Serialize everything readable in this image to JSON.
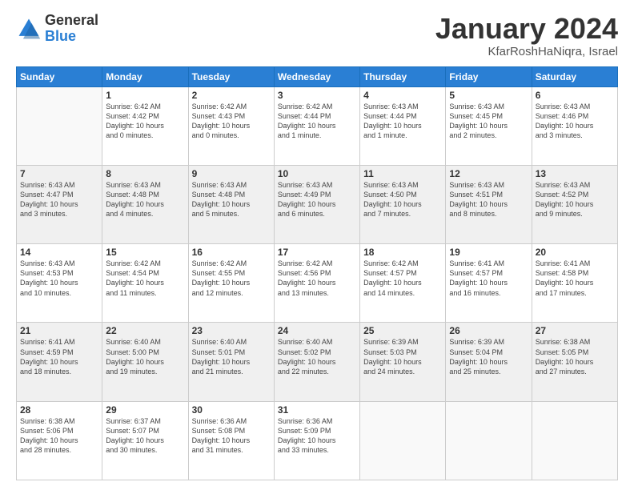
{
  "header": {
    "logo_general": "General",
    "logo_blue": "Blue",
    "month_title": "January 2024",
    "location": "KfarRoshHaNiqra, Israel"
  },
  "weekdays": [
    "Sunday",
    "Monday",
    "Tuesday",
    "Wednesday",
    "Thursday",
    "Friday",
    "Saturday"
  ],
  "weeks": [
    [
      {
        "day": "",
        "info": ""
      },
      {
        "day": "1",
        "info": "Sunrise: 6:42 AM\nSunset: 4:42 PM\nDaylight: 10 hours\nand 0 minutes."
      },
      {
        "day": "2",
        "info": "Sunrise: 6:42 AM\nSunset: 4:43 PM\nDaylight: 10 hours\nand 0 minutes."
      },
      {
        "day": "3",
        "info": "Sunrise: 6:42 AM\nSunset: 4:44 PM\nDaylight: 10 hours\nand 1 minute."
      },
      {
        "day": "4",
        "info": "Sunrise: 6:43 AM\nSunset: 4:44 PM\nDaylight: 10 hours\nand 1 minute."
      },
      {
        "day": "5",
        "info": "Sunrise: 6:43 AM\nSunset: 4:45 PM\nDaylight: 10 hours\nand 2 minutes."
      },
      {
        "day": "6",
        "info": "Sunrise: 6:43 AM\nSunset: 4:46 PM\nDaylight: 10 hours\nand 3 minutes."
      }
    ],
    [
      {
        "day": "7",
        "info": "Sunrise: 6:43 AM\nSunset: 4:47 PM\nDaylight: 10 hours\nand 3 minutes."
      },
      {
        "day": "8",
        "info": "Sunrise: 6:43 AM\nSunset: 4:48 PM\nDaylight: 10 hours\nand 4 minutes."
      },
      {
        "day": "9",
        "info": "Sunrise: 6:43 AM\nSunset: 4:48 PM\nDaylight: 10 hours\nand 5 minutes."
      },
      {
        "day": "10",
        "info": "Sunrise: 6:43 AM\nSunset: 4:49 PM\nDaylight: 10 hours\nand 6 minutes."
      },
      {
        "day": "11",
        "info": "Sunrise: 6:43 AM\nSunset: 4:50 PM\nDaylight: 10 hours\nand 7 minutes."
      },
      {
        "day": "12",
        "info": "Sunrise: 6:43 AM\nSunset: 4:51 PM\nDaylight: 10 hours\nand 8 minutes."
      },
      {
        "day": "13",
        "info": "Sunrise: 6:43 AM\nSunset: 4:52 PM\nDaylight: 10 hours\nand 9 minutes."
      }
    ],
    [
      {
        "day": "14",
        "info": "Sunrise: 6:43 AM\nSunset: 4:53 PM\nDaylight: 10 hours\nand 10 minutes."
      },
      {
        "day": "15",
        "info": "Sunrise: 6:42 AM\nSunset: 4:54 PM\nDaylight: 10 hours\nand 11 minutes."
      },
      {
        "day": "16",
        "info": "Sunrise: 6:42 AM\nSunset: 4:55 PM\nDaylight: 10 hours\nand 12 minutes."
      },
      {
        "day": "17",
        "info": "Sunrise: 6:42 AM\nSunset: 4:56 PM\nDaylight: 10 hours\nand 13 minutes."
      },
      {
        "day": "18",
        "info": "Sunrise: 6:42 AM\nSunset: 4:57 PM\nDaylight: 10 hours\nand 14 minutes."
      },
      {
        "day": "19",
        "info": "Sunrise: 6:41 AM\nSunset: 4:57 PM\nDaylight: 10 hours\nand 16 minutes."
      },
      {
        "day": "20",
        "info": "Sunrise: 6:41 AM\nSunset: 4:58 PM\nDaylight: 10 hours\nand 17 minutes."
      }
    ],
    [
      {
        "day": "21",
        "info": "Sunrise: 6:41 AM\nSunset: 4:59 PM\nDaylight: 10 hours\nand 18 minutes."
      },
      {
        "day": "22",
        "info": "Sunrise: 6:40 AM\nSunset: 5:00 PM\nDaylight: 10 hours\nand 19 minutes."
      },
      {
        "day": "23",
        "info": "Sunrise: 6:40 AM\nSunset: 5:01 PM\nDaylight: 10 hours\nand 21 minutes."
      },
      {
        "day": "24",
        "info": "Sunrise: 6:40 AM\nSunset: 5:02 PM\nDaylight: 10 hours\nand 22 minutes."
      },
      {
        "day": "25",
        "info": "Sunrise: 6:39 AM\nSunset: 5:03 PM\nDaylight: 10 hours\nand 24 minutes."
      },
      {
        "day": "26",
        "info": "Sunrise: 6:39 AM\nSunset: 5:04 PM\nDaylight: 10 hours\nand 25 minutes."
      },
      {
        "day": "27",
        "info": "Sunrise: 6:38 AM\nSunset: 5:05 PM\nDaylight: 10 hours\nand 27 minutes."
      }
    ],
    [
      {
        "day": "28",
        "info": "Sunrise: 6:38 AM\nSunset: 5:06 PM\nDaylight: 10 hours\nand 28 minutes."
      },
      {
        "day": "29",
        "info": "Sunrise: 6:37 AM\nSunset: 5:07 PM\nDaylight: 10 hours\nand 30 minutes."
      },
      {
        "day": "30",
        "info": "Sunrise: 6:36 AM\nSunset: 5:08 PM\nDaylight: 10 hours\nand 31 minutes."
      },
      {
        "day": "31",
        "info": "Sunrise: 6:36 AM\nSunset: 5:09 PM\nDaylight: 10 hours\nand 33 minutes."
      },
      {
        "day": "",
        "info": ""
      },
      {
        "day": "",
        "info": ""
      },
      {
        "day": "",
        "info": ""
      }
    ]
  ]
}
